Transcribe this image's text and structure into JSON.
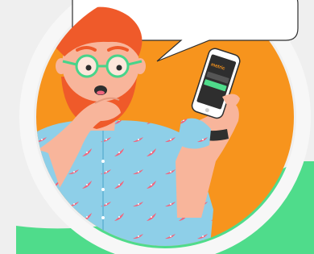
{
  "scene": {
    "colors": {
      "background": "#efefef",
      "ring": "#f7f7f7",
      "orange_disc": "#f7941d",
      "green_accent": "#4fdc8b",
      "speech_bubble": "#ffffff",
      "hair_beard": "#ef5a2a",
      "skin": "#f8b59b",
      "glasses": "#47d48a",
      "shirt": "#8ecfe8",
      "shirt_pattern": "#f1657d",
      "watch_band": "#2f2f2f",
      "phone_body": "#ffffff",
      "phone_screen": "#2e2e2e",
      "phone_brand": "#f7941d",
      "phone_button": "#4fdc8b"
    },
    "icons": [
      "speech-bubble-icon",
      "phone-icon",
      "watermelon-slice-icon",
      "wristwatch-icon"
    ],
    "phone_screen_text": "metric"
  }
}
